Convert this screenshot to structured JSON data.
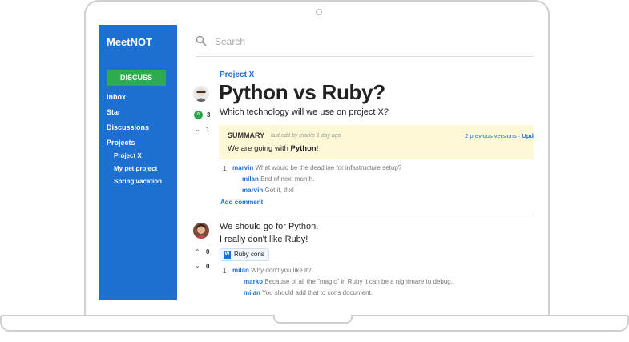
{
  "app": {
    "brand": "MeetNOT",
    "discuss_button": "DISCUSS"
  },
  "sidebar": {
    "items": [
      {
        "label": "Inbox"
      },
      {
        "label": "Star"
      },
      {
        "label": "Discussions"
      },
      {
        "label": "Projects"
      }
    ],
    "projects": [
      {
        "label": "Project X"
      },
      {
        "label": "My pet project"
      },
      {
        "label": "Spring vacation"
      }
    ]
  },
  "search": {
    "placeholder": "Search",
    "value": ""
  },
  "question": {
    "project": "Project X",
    "title": "Python vs Ruby?",
    "subtitle": "Which technology will we use on project X?",
    "upvotes": "3",
    "downvotes": "1"
  },
  "summary": {
    "label": "SUMMARY",
    "meta_prefix": "last edit by",
    "meta_user": "marko",
    "meta_time": "1 day ago",
    "versions_link": "2 previous versions",
    "separator": "·",
    "update_link": "Upd",
    "text_prefix": "We are going with ",
    "text_bold": "Python",
    "text_suffix": "!"
  },
  "question_comments": {
    "count": "1",
    "items": [
      {
        "user": "marvin",
        "text": "What would be the deadline for infastructure setup?"
      },
      {
        "user": "milan",
        "text": "End of next month."
      },
      {
        "user": "marvin",
        "text": "Got it, thx!"
      }
    ],
    "add_comment": "Add comment"
  },
  "answer": {
    "line1": "We should go for Python.",
    "line2": "I really don't like Ruby!",
    "upvotes": "0",
    "downvotes": "0",
    "tag_icon": "W",
    "tag_label": "Ruby cons"
  },
  "answer_comments": {
    "count": "1",
    "items": [
      {
        "user": "milan",
        "text": "Why don't you like it?"
      },
      {
        "user": "marko",
        "text": "Because of all the \"magic\" in Ruby it can be a nightmare to debug."
      },
      {
        "user": "milan",
        "text": "You should add that to cons document."
      }
    ]
  },
  "colors": {
    "sidebar": "#1d6fd0",
    "discuss": "#2eab4d",
    "summary_bg": "#fdf8d5",
    "link": "#1d6fd0"
  }
}
